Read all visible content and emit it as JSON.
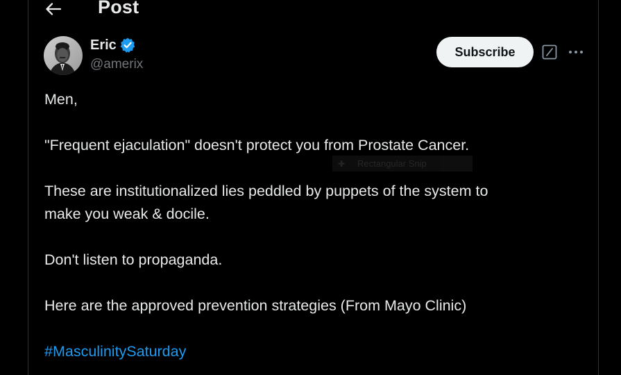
{
  "header": {
    "title": "Post",
    "back_icon": "arrow-left-icon"
  },
  "author": {
    "name": "Eric",
    "handle": "@amerix",
    "verified": true,
    "verified_color": "#1d9bf0"
  },
  "actions": {
    "subscribe_label": "Subscribe",
    "grok_icon": "grok-icon",
    "more_icon": "more-dots-icon"
  },
  "tweet": {
    "line1": "Men,",
    "line2": "\"Frequent ejaculation\" doesn't protect you from Prostate Cancer.",
    "line3": "These are institutionalized lies peddled by puppets of the system to",
    "line4": "make you weak & docile.",
    "line5": "Don't listen to propaganda.",
    "line6": "Here are the approved prevention strategies (From Mayo Clinic)",
    "hashtag": "#MasculinitySaturday"
  },
  "overlay": {
    "label": "Rectangular Snip"
  },
  "colors": {
    "background": "#000000",
    "text": "#e7e9ea",
    "secondary_text": "#71767b",
    "link": "#1d9bf0",
    "border": "#2f3336",
    "button_bg": "#eff3f4"
  }
}
